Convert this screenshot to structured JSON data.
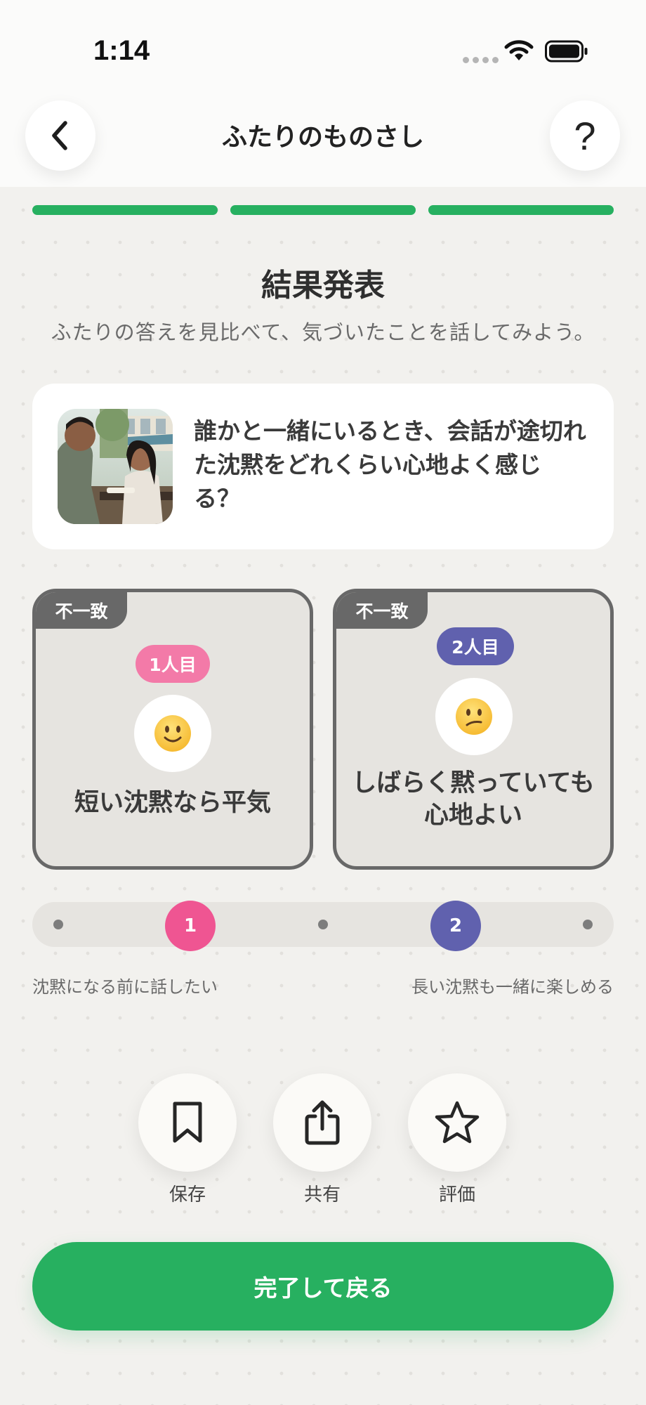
{
  "status_bar": {
    "time": "1:14"
  },
  "header": {
    "title": "ふたりのものさし",
    "back_icon": "chevron-left-icon",
    "help_label": "?"
  },
  "progress": {
    "steps_total": 3,
    "steps_completed": 3,
    "color": "#27b060"
  },
  "result": {
    "title": "結果発表",
    "subtitle": "ふたりの答えを見比べて、気づいたことを話してみよう。"
  },
  "question": {
    "text": "誰かと一緒にいるとき、会話が途切れた沈黙をどれくらい心地よく感じる？"
  },
  "answers": [
    {
      "tag": "不一致",
      "person": "1人目",
      "emoji": "slightly-smiling-face",
      "answer": "短い沈黙なら平気",
      "badge_color": "#f37aa8"
    },
    {
      "tag": "不一致",
      "person": "2人目",
      "emoji": "confused-face",
      "answer": "しばらく黙っていても心地よい",
      "badge_color": "#6061ae"
    }
  ],
  "scale": {
    "points": 5,
    "markers": [
      {
        "label": "1",
        "position": 2,
        "color": "#ef5592"
      },
      {
        "label": "2",
        "position": 4,
        "color": "#6061ae"
      }
    ],
    "left_label": "沈黙になる前に話したい",
    "right_label": "長い沈黙も一緒に楽しめる"
  },
  "actions": [
    {
      "label": "保存",
      "icon": "bookmark-icon"
    },
    {
      "label": "共有",
      "icon": "share-icon"
    },
    {
      "label": "評価",
      "icon": "star-icon"
    }
  ],
  "primary_button": {
    "label": "完了して戻る",
    "color": "#27b060"
  }
}
